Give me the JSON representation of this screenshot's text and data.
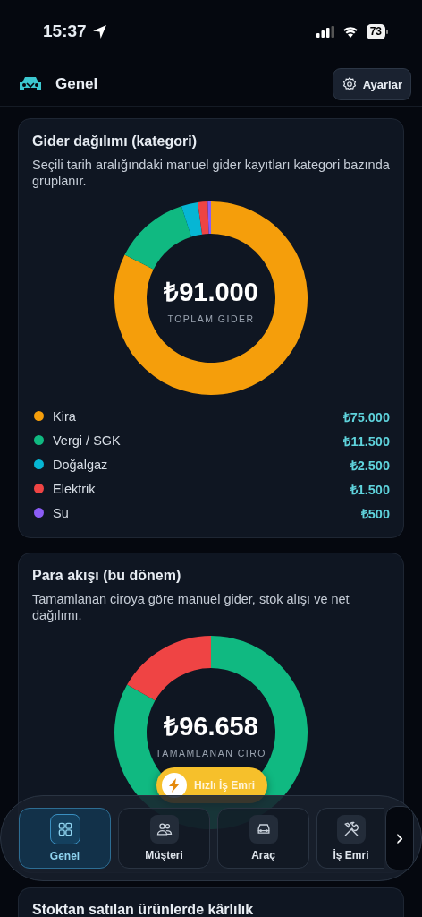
{
  "status_bar": {
    "time": "15:37",
    "battery": "73"
  },
  "header": {
    "title": "Genel",
    "settings_button": "Ayarlar"
  },
  "expense_card": {
    "title": "Gider dağılımı (kategori)",
    "description": "Seçili tarih aralığındaki manuel gider kayıtları kategori bazında gruplanır.",
    "total": "₺91.000",
    "total_label": "TOPLAM GIDER",
    "chart_data": {
      "type": "donut",
      "categories": [
        "Kira",
        "Vergi / SGK",
        "Doğalgaz",
        "Elektrik",
        "Su"
      ],
      "series": [
        {
          "values": [
            82.41,
            12.64,
            2.75,
            1.65,
            0.55
          ]
        }
      ]
    },
    "legend": [
      {
        "value": "₺75.000",
        "color": "#f59e0b"
      },
      {
        "value": "₺11.500",
        "color": "#10b981"
      },
      {
        "value": "₺2.500",
        "color": "#06b6d4"
      },
      {
        "value": "₺1.500",
        "color": "#ef4444"
      },
      {
        "value": "₺500",
        "color": "#8b5cf6"
      }
    ]
  },
  "cashflow_card": {
    "title": "Para akışı (bu dönem)",
    "description": "Tamamlanan ciroya göre manuel gider, stok alışı ve net dağılımı.",
    "total": "₺96.658",
    "total_label": "TAMAMLANAN CIRO"
  },
  "profit_card": {
    "title": "Stoktan satılan ürünlerde kârlılık"
  },
  "quick_action": {
    "label": "Hızlı İş Emri"
  },
  "bottom_nav": {
    "items": [
      {
        "kind": "grid",
        "label": "Genel",
        "selected": true
      },
      {
        "kind": "people",
        "label": "Müşteri",
        "selected": false
      },
      {
        "kind": "car",
        "label": "Araç",
        "selected": false
      },
      {
        "kind": "tools",
        "label": "İş Emri",
        "selected": false
      }
    ],
    "more": "›"
  }
}
